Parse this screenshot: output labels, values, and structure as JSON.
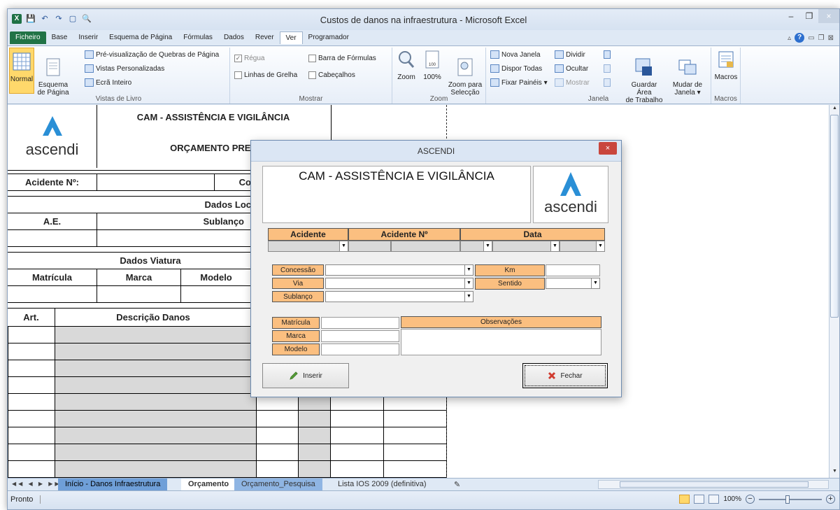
{
  "window": {
    "title": "Custos de danos na infraestrutura  -  Microsoft Excel",
    "controls": [
      "–",
      "❐",
      "×"
    ]
  },
  "qat": {
    "logo": "X",
    "save": "💾",
    "undo": "↶",
    "redo": "↷",
    "new": "▢",
    "preview": "🔍"
  },
  "tabs": [
    "Ficheiro",
    "Base",
    "Inserir",
    "Esquema de Página",
    "Fórmulas",
    "Dados",
    "Rever",
    "Ver",
    "Programador"
  ],
  "ribbon": {
    "vistas": {
      "normal": "Normal",
      "esquema": "Esquema\nde Página",
      "quebras": "Pré-visualização de Quebras de Página",
      "personalizadas": "Vistas Personalizadas",
      "ecra": "Ecrã Inteiro",
      "label": "Vistas de Livro"
    },
    "mostrar": {
      "regua": "Régua",
      "barra": "Barra de Fórmulas",
      "grelha": "Linhas de Grelha",
      "cabecalhos": "Cabeçalhos",
      "label": "Mostrar"
    },
    "zoom": {
      "zoom": "Zoom",
      "cem": "100%",
      "selecao": "Zoom para\nSelecção",
      "label": "Zoom"
    },
    "janela": {
      "nova": "Nova Janela",
      "dispor": "Dispor Todas",
      "fixar": "Fixar Painéis ▾",
      "dividir": "Dividir",
      "ocultar": "Ocultar",
      "mostrar": "Mostrar",
      "guardar": "Guardar Área\nde Trabalho",
      "mudar": "Mudar de\nJanela ▾",
      "label": "Janela"
    },
    "macros": {
      "macros": "Macros",
      "label": "Macros"
    }
  },
  "sheet": {
    "logo": "ascendi",
    "header1": "CAM - ASSISTÊNCIA E VIGILÂNCIA",
    "header2": "ORÇAMENTO PRELI",
    "acidente": "Acidente Nº:",
    "co": "Co",
    "dados_loc": "Dados Loc",
    "ae": "A.E.",
    "sublanco": "Sublanço",
    "dados_viatura": "Dados Viatura",
    "matricula": "Matrícula",
    "marca": "Marca",
    "modelo": "Modelo",
    "art": "Art.",
    "descricao": "Descrição Danos"
  },
  "sheettabs": {
    "nav": "◀◀ ◀ ▶ ▶▶",
    "tabs": [
      "Início - Danos Infraestrutura",
      "Orçamento",
      "Orçamento_Pesquisa",
      "Lista IOS 2009 (definitiva)"
    ]
  },
  "status": {
    "text": "Pronto",
    "zoom": "100%",
    "minus": "−",
    "plus": "+"
  },
  "dialog": {
    "title": "ASCENDI",
    "close": "×",
    "header": "CAM - ASSISTÊNCIA E VIGILÂNCIA",
    "logo": "ascendi",
    "col_acidente": "Acidente",
    "col_acidente_no": "Acidente Nº",
    "col_data": "Data",
    "concessao": "Concessão",
    "via": "Via",
    "sublanco": "Sublanço",
    "km": "Km",
    "sentido": "Sentido",
    "matricula": "Matrícula",
    "marca": "Marca",
    "modelo": "Modelo",
    "observacoes": "Observações",
    "inserir": "Inserir",
    "fechar": "Fechar"
  },
  "colors": {
    "accent_orange": "#fbbf80",
    "excel_green": "#217346",
    "ascendi_blue": "#2a8fd6"
  }
}
